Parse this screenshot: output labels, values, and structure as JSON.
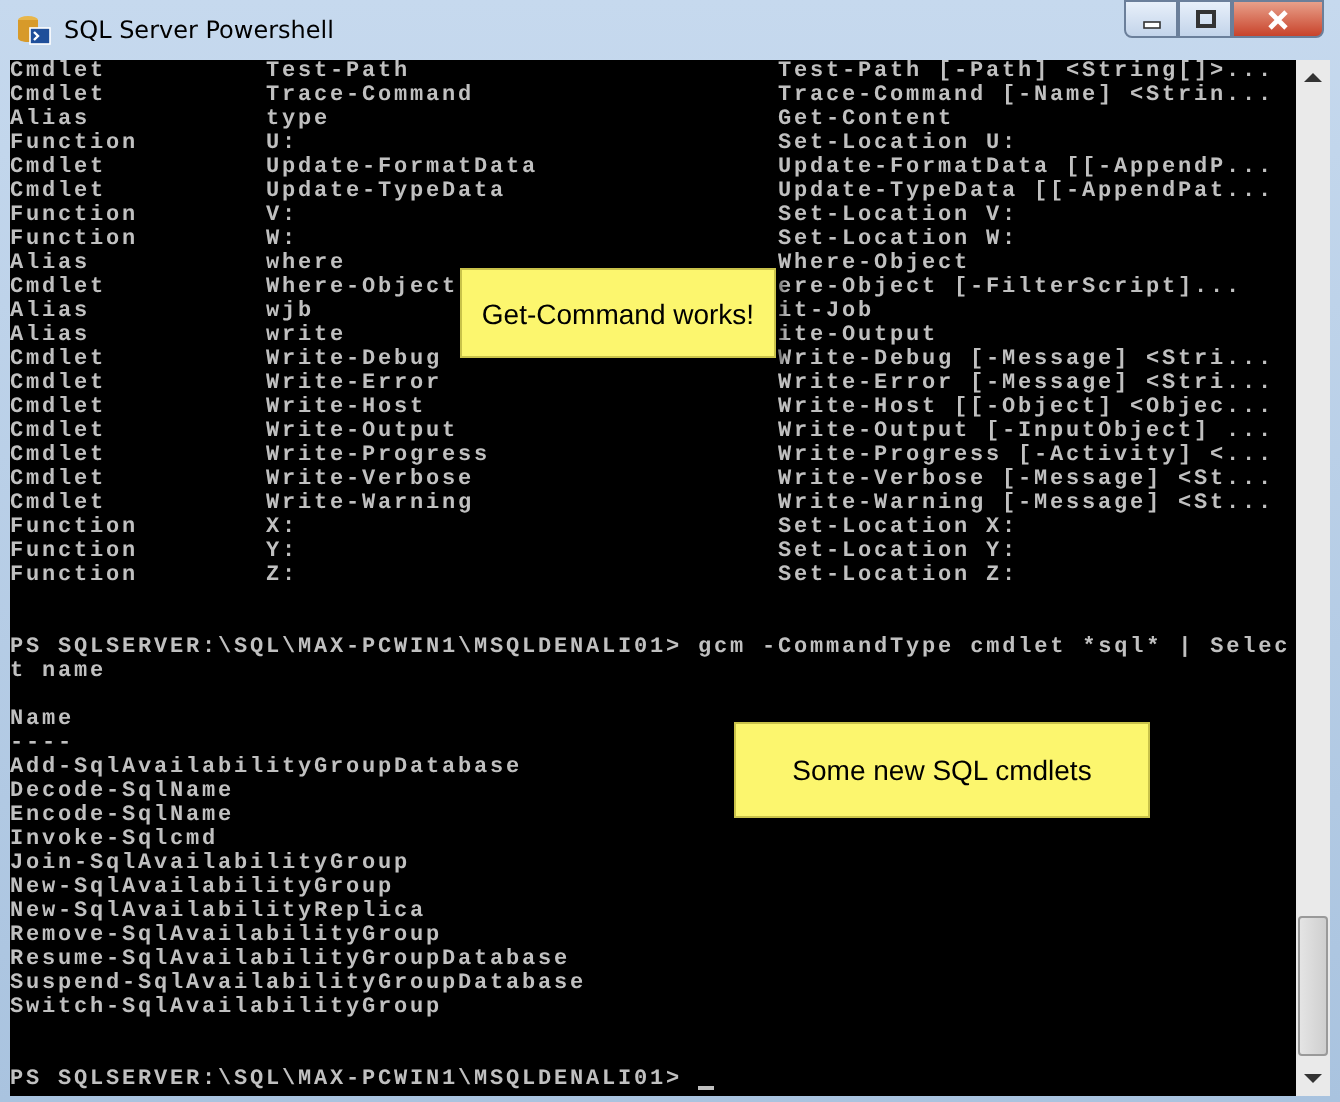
{
  "window": {
    "title": "SQL Server Powershell"
  },
  "console": {
    "lines": [
      {
        "kind": "row",
        "type": "Cmdlet",
        "name": "Test-Path",
        "definition": "Test-Path [-Path] <String[]>..."
      },
      {
        "kind": "row",
        "type": "Cmdlet",
        "name": "Trace-Command",
        "definition": "Trace-Command [-Name] <Strin..."
      },
      {
        "kind": "row",
        "type": "Alias",
        "name": "type",
        "definition": "Get-Content"
      },
      {
        "kind": "row",
        "type": "Function",
        "name": "U:",
        "definition": "Set-Location U:"
      },
      {
        "kind": "row",
        "type": "Cmdlet",
        "name": "Update-FormatData",
        "definition": "Update-FormatData [[-AppendP..."
      },
      {
        "kind": "row",
        "type": "Cmdlet",
        "name": "Update-TypeData",
        "definition": "Update-TypeData [[-AppendPat..."
      },
      {
        "kind": "row",
        "type": "Function",
        "name": "V:",
        "definition": "Set-Location V:"
      },
      {
        "kind": "row",
        "type": "Function",
        "name": "W:",
        "definition": "Set-Location W:"
      },
      {
        "kind": "row",
        "type": "Alias",
        "name": "where",
        "definition": "Where-Object"
      },
      {
        "kind": "row",
        "type": "Cmdlet",
        "name": "Where-Object",
        "definition": "ere-Object [-FilterScript]..."
      },
      {
        "kind": "row",
        "type": "Alias",
        "name": "wjb",
        "definition": "it-Job"
      },
      {
        "kind": "row",
        "type": "Alias",
        "name": "write",
        "definition": "ite-Output"
      },
      {
        "kind": "row",
        "type": "Cmdlet",
        "name": "Write-Debug",
        "definition": "Write-Debug [-Message] <Stri..."
      },
      {
        "kind": "row",
        "type": "Cmdlet",
        "name": "Write-Error",
        "definition": "Write-Error [-Message] <Stri..."
      },
      {
        "kind": "row",
        "type": "Cmdlet",
        "name": "Write-Host",
        "definition": "Write-Host [[-Object] <Objec..."
      },
      {
        "kind": "row",
        "type": "Cmdlet",
        "name": "Write-Output",
        "definition": "Write-Output [-InputObject] ..."
      },
      {
        "kind": "row",
        "type": "Cmdlet",
        "name": "Write-Progress",
        "definition": "Write-Progress [-Activity] <..."
      },
      {
        "kind": "row",
        "type": "Cmdlet",
        "name": "Write-Verbose",
        "definition": "Write-Verbose [-Message] <St..."
      },
      {
        "kind": "row",
        "type": "Cmdlet",
        "name": "Write-Warning",
        "definition": "Write-Warning [-Message] <St..."
      },
      {
        "kind": "row",
        "type": "Function",
        "name": "X:",
        "definition": "Set-Location X:"
      },
      {
        "kind": "row",
        "type": "Function",
        "name": "Y:",
        "definition": "Set-Location Y:"
      },
      {
        "kind": "row",
        "type": "Function",
        "name": "Z:",
        "definition": "Set-Location Z:"
      },
      {
        "kind": "blank"
      },
      {
        "kind": "blank"
      },
      {
        "kind": "text",
        "text": "PS SQLSERVER:\\SQL\\MAX-PCWIN1\\MSQLDENALI01> gcm -CommandType cmdlet *sql* | Selec"
      },
      {
        "kind": "text",
        "text": "t name"
      },
      {
        "kind": "blank"
      },
      {
        "kind": "text",
        "text": "Name"
      },
      {
        "kind": "text",
        "text": "----"
      },
      {
        "kind": "text",
        "text": "Add-SqlAvailabilityGroupDatabase"
      },
      {
        "kind": "text",
        "text": "Decode-SqlName"
      },
      {
        "kind": "text",
        "text": "Encode-SqlName"
      },
      {
        "kind": "text",
        "text": "Invoke-Sqlcmd"
      },
      {
        "kind": "text",
        "text": "Join-SqlAvailabilityGroup"
      },
      {
        "kind": "text",
        "text": "New-SqlAvailabilityGroup"
      },
      {
        "kind": "text",
        "text": "New-SqlAvailabilityReplica"
      },
      {
        "kind": "text",
        "text": "Remove-SqlAvailabilityGroup"
      },
      {
        "kind": "text",
        "text": "Resume-SqlAvailabilityGroupDatabase"
      },
      {
        "kind": "text",
        "text": "Suspend-SqlAvailabilityGroupDatabase"
      },
      {
        "kind": "text",
        "text": "Switch-SqlAvailabilityGroup"
      },
      {
        "kind": "blank"
      },
      {
        "kind": "blank"
      },
      {
        "kind": "prompt",
        "text": "PS SQLSERVER:\\SQL\\MAX-PCWIN1\\MSQLDENALI01>"
      }
    ]
  },
  "callouts": [
    {
      "text": "Get-Command works!",
      "kind": "top"
    },
    {
      "text": "Some new SQL cmdlets",
      "kind": "bottom"
    }
  ]
}
